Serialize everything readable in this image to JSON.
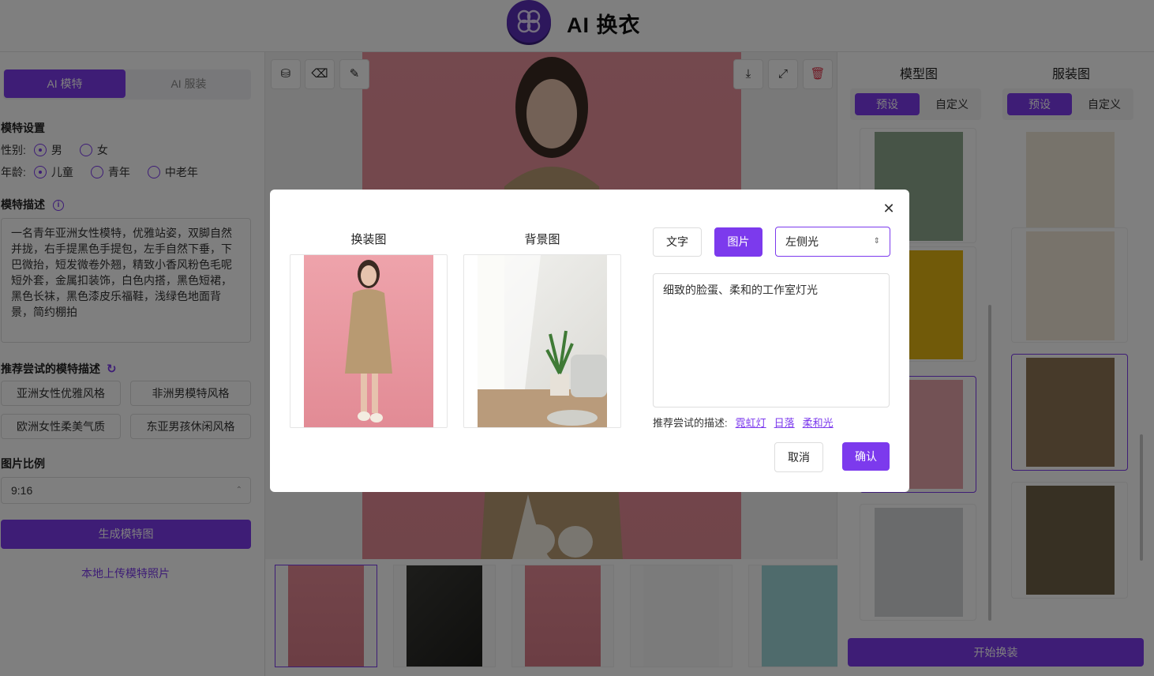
{
  "app": {
    "title": "AI 换衣",
    "logo_icon": "flower-logo"
  },
  "left": {
    "tabs": [
      {
        "label": "AI 模特",
        "active": true
      },
      {
        "label": "AI 服装",
        "active": false
      }
    ],
    "model_settings": {
      "title": "模特设置",
      "gender_label": "性别:",
      "gender_options": [
        {
          "label": "男",
          "checked": true
        },
        {
          "label": "女",
          "checked": false
        }
      ],
      "age_label": "年龄:",
      "age_options": [
        {
          "label": "儿童",
          "checked": true
        },
        {
          "label": "青年",
          "checked": false
        },
        {
          "label": "中老年",
          "checked": false
        }
      ]
    },
    "description": {
      "title": "模特描述",
      "text": "一名青年亚洲女性模特，优雅站姿，双脚自然并拢，右手提黑色手提包，左手自然下垂，下巴微抬，短发微卷外翘，精致小香风粉色毛呢短外套，金属扣装饰，白色内搭，黑色短裙，黑色长袜，黑色漆皮乐福鞋，浅绿色地面背景，简约棚拍"
    },
    "recommend": {
      "title": "推荐尝试的模特描述",
      "chips": [
        "亚洲女性优雅风格",
        "非洲男模特风格",
        "欧洲女性柔美气质",
        "东亚男孩休闲风格"
      ]
    },
    "ratio": {
      "title": "图片比例",
      "value": "9:16"
    },
    "generate_label": "生成模特图",
    "upload_label": "本地上传模特照片"
  },
  "center": {
    "toolbar_left": [
      "bucket-icon",
      "eraser-icon",
      "brush-icon"
    ],
    "toolbar_right": [
      "download-icon",
      "fullscreen-icon",
      "delete-icon"
    ]
  },
  "right": {
    "model_col": {
      "title": "模型图",
      "tabs": [
        "预设",
        "自定义"
      ]
    },
    "clothes_col": {
      "title": "服装图",
      "tabs": [
        "预设",
        "自定义"
      ]
    },
    "start_label": "开始换装"
  },
  "dialog": {
    "swap_label": "换装图",
    "bg_label": "背景图",
    "mode_text": "文字",
    "mode_image": "图片",
    "light_select": "左侧光",
    "prompt": "细致的脸蛋、柔和的工作室灯光",
    "suggest_label": "推荐尝试的描述:",
    "suggest_items": [
      "霓虹灯",
      "日落",
      "柔和光"
    ],
    "cancel": "取消",
    "confirm": "确认"
  },
  "colors": {
    "accent": "#7c3aed",
    "pink_bg": "#e9929c",
    "coat": "#b89a72"
  }
}
